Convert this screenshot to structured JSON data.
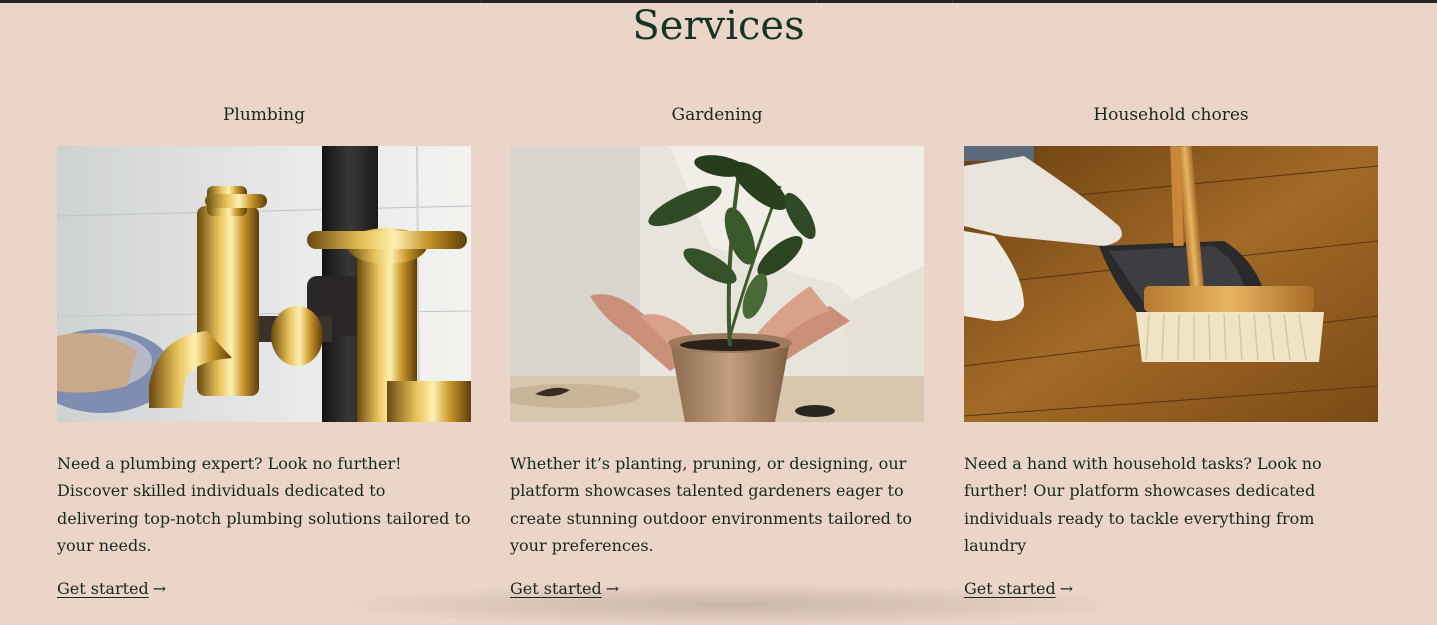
{
  "section": {
    "title": "Services"
  },
  "cards": [
    {
      "title": "Plumbing",
      "image": "brass-taps-photo",
      "description": "Need a plumbing expert? Look no further! Discover skilled individuals dedicated to delivering top-notch plumbing solutions tailored to your needs.",
      "cta": "Get started",
      "arrow": "→"
    },
    {
      "title": "Gardening",
      "image": "potted-plant-photo",
      "description": "Whether it’s planting, pruning, or designing, our platform showcases talented gardeners eager to create stunning outdoor environments tailored to your preferences.",
      "cta": "Get started",
      "arrow": "→"
    },
    {
      "title": "Household chores",
      "image": "broom-dustpan-photo",
      "description": "Need a hand with household tasks? Look no further! Our platform showcases dedicated individuals ready to tackle everything from laundry",
      "cta": "Get started",
      "arrow": "→"
    }
  ],
  "colors": {
    "background": "#ead5c8",
    "title": "#133526",
    "text": "#17271f"
  }
}
